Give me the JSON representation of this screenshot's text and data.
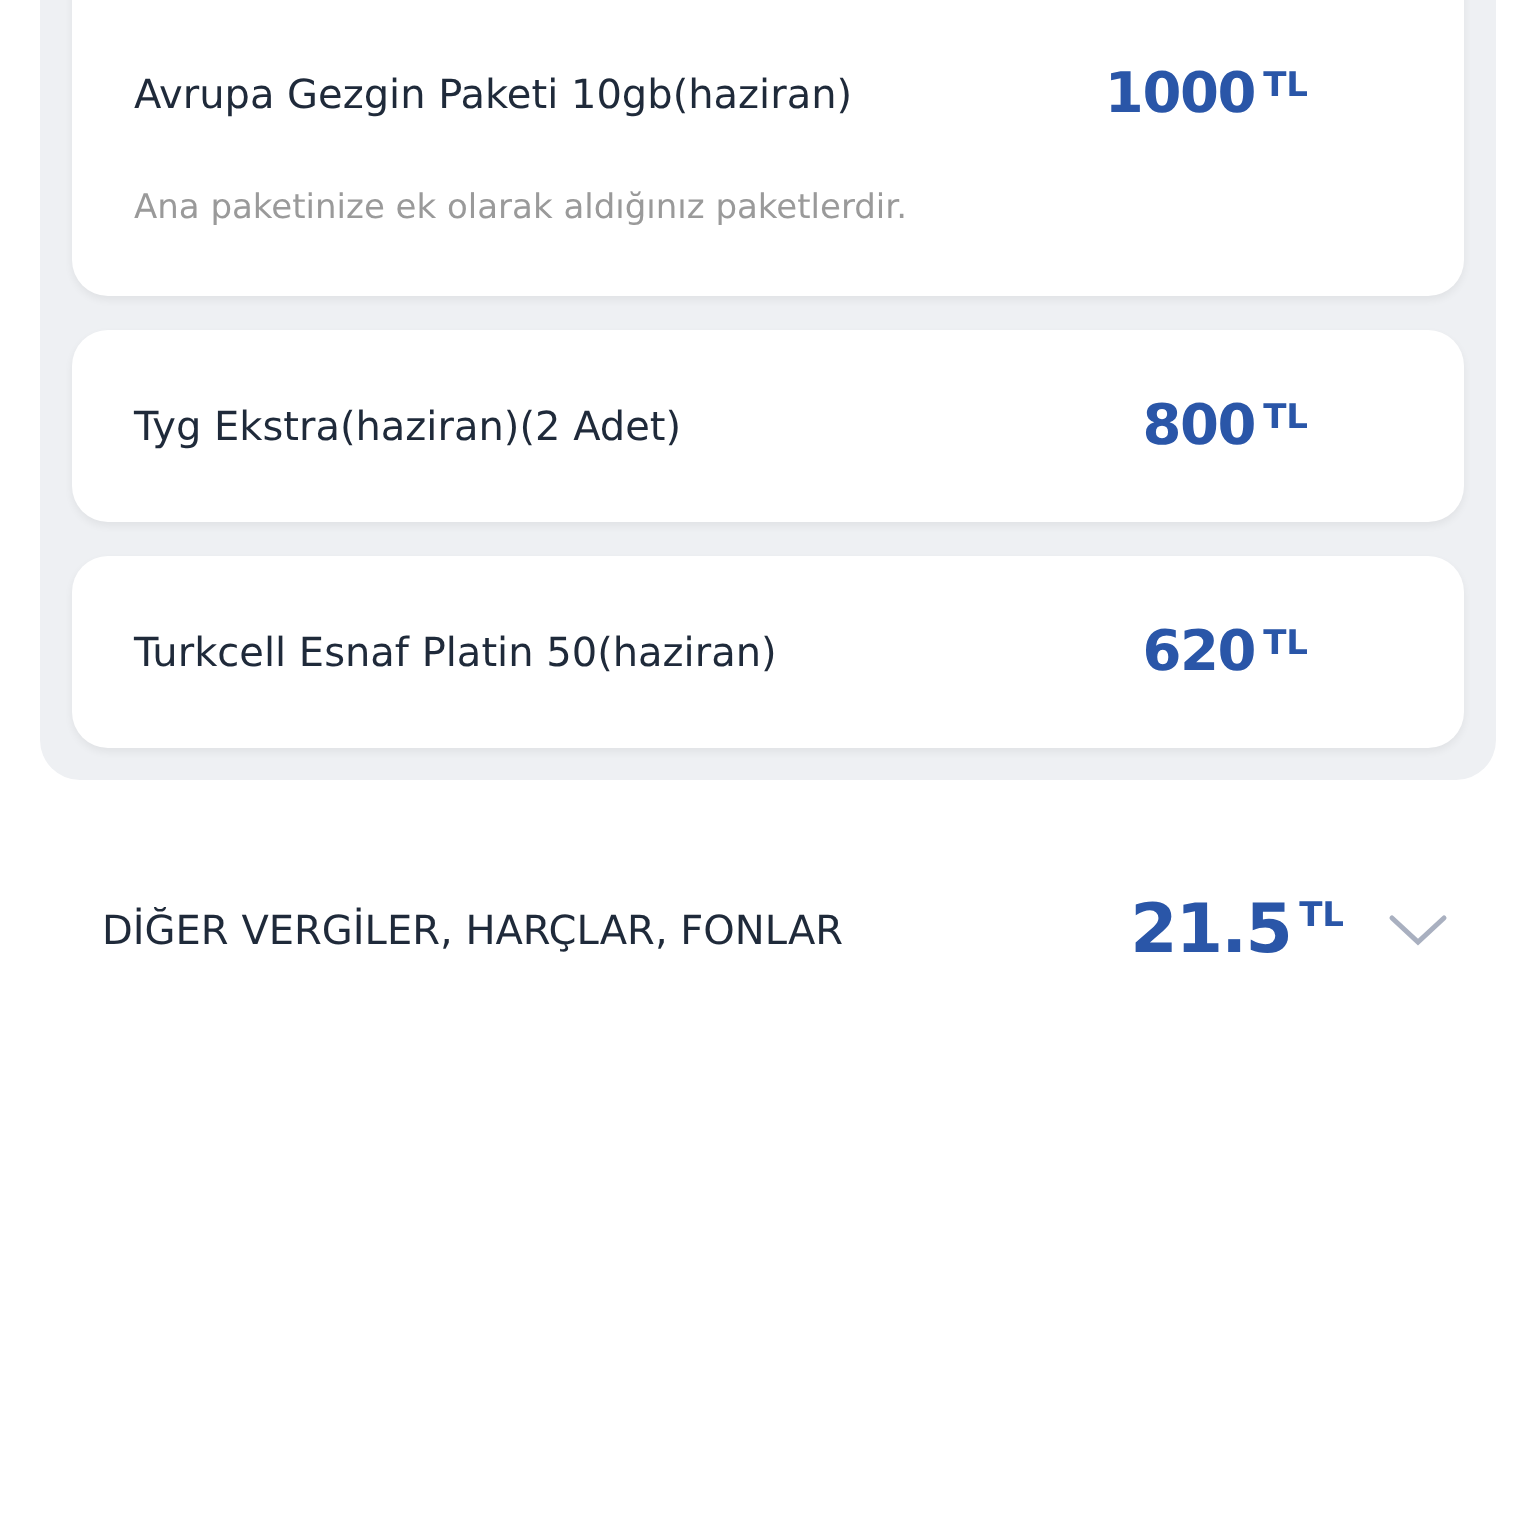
{
  "packages": [
    {
      "name": "Avrupa Gezgin Paketi 10gb(haziran)",
      "amount": "1000",
      "currency": "TL",
      "note": "Ana paketinize ek olarak aldığınız paketlerdir."
    },
    {
      "name": "Tyg Ekstra(haziran)(2 Adet)",
      "amount": "800",
      "currency": "TL"
    },
    {
      "name": "Turkcell Esnaf Platin 50(haziran)",
      "amount": "620",
      "currency": "TL"
    }
  ],
  "section": {
    "title": "DİĞER VERGİLER, HARÇLAR, FONLAR",
    "amount": "21.5",
    "currency": "TL",
    "expanded": false
  }
}
